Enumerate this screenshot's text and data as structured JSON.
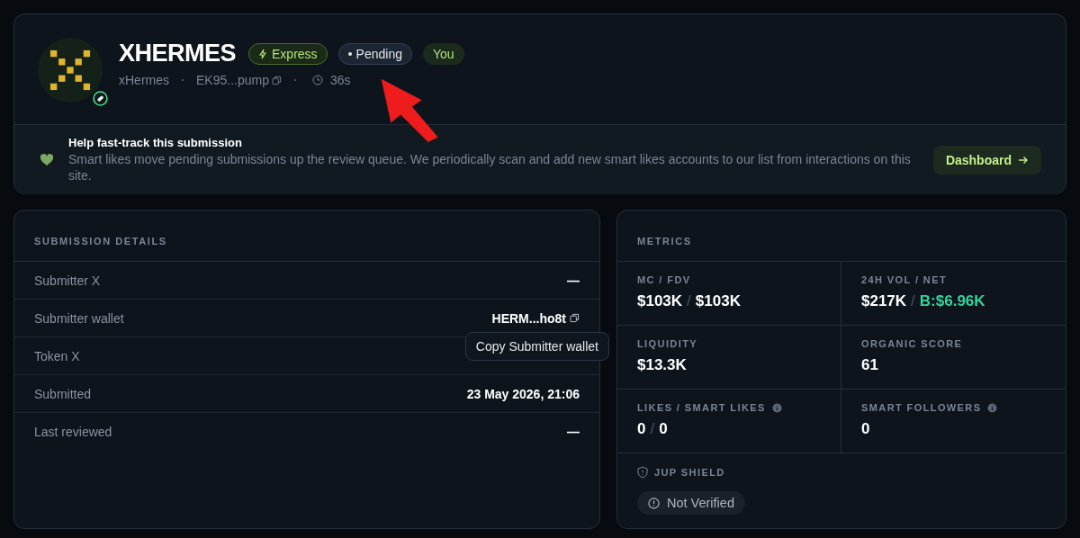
{
  "token": {
    "name": "XHERMES",
    "badges": [
      {
        "text": "Express",
        "kind": "express"
      },
      {
        "text": "Pending",
        "kind": "pending"
      },
      {
        "text": "You",
        "kind": "you"
      }
    ],
    "handle": "xHermes",
    "address": "EK95...pump",
    "age": "36s"
  },
  "notice": {
    "title": "Help fast-track this submission",
    "text": "Smart likes move pending submissions up the review queue. We periodically scan and add new smart likes accounts to our list from interactions on this site.",
    "button": "Dashboard"
  },
  "details": {
    "title": "SUBMISSION DETAILS",
    "rows": [
      {
        "label": "Submitter X",
        "value": "—",
        "kind": "plain"
      },
      {
        "label": "Submitter wallet",
        "value": "HERM...ho8t",
        "kind": "copy"
      },
      {
        "label": "Token X",
        "kind": "hidden"
      },
      {
        "label": "Submitted",
        "value": "23 May 2026, 21:06",
        "kind": "plain"
      },
      {
        "label": "Last reviewed",
        "value": "—",
        "kind": "plain"
      }
    ],
    "tooltip": "Copy Submitter wallet"
  },
  "metrics": {
    "title": "METRICS",
    "cells": [
      {
        "label": "MC / FDV",
        "info": false,
        "parts": [
          {
            "text": "$103K",
            "kind": "default"
          },
          {
            "text": "$103K",
            "kind": "default"
          }
        ]
      },
      {
        "label": "24H VOL / NET",
        "info": false,
        "parts": [
          {
            "text": "$217K",
            "kind": "default"
          },
          {
            "text": "B:$6.96K",
            "kind": "positive"
          }
        ]
      },
      {
        "label": "LIQUIDITY",
        "info": false,
        "parts": [
          {
            "text": "$13.3K",
            "kind": "default"
          }
        ]
      },
      {
        "label": "ORGANIC SCORE",
        "info": false,
        "parts": [
          {
            "text": "61",
            "kind": "default"
          }
        ]
      },
      {
        "label": "LIKES / SMART LIKES",
        "info": true,
        "parts": [
          {
            "text": "0",
            "kind": "default"
          },
          {
            "text": "0",
            "kind": "default"
          }
        ]
      },
      {
        "label": "SMART FOLLOWERS",
        "info": true,
        "parts": [
          {
            "text": "0",
            "kind": "default"
          }
        ]
      }
    ],
    "sep": "/",
    "shield": {
      "title": "JUP SHIELD",
      "status": "Not Verified"
    }
  }
}
